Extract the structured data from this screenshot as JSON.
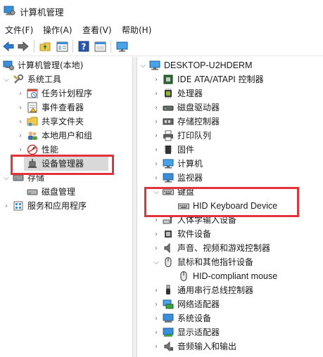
{
  "window": {
    "title": "计算机管理"
  },
  "menu": [
    {
      "label": "文件(F)"
    },
    {
      "label": "操作(A)"
    },
    {
      "label": "查看(V)"
    },
    {
      "label": "帮助(H)"
    }
  ],
  "toolbar": {
    "buttons": [
      "back-icon",
      "forward-icon",
      "up-folder-icon",
      "show-hide-console-tree-icon",
      "help-icon",
      "properties-icon",
      "monitor-icon"
    ]
  },
  "left_tree": {
    "root": "计算机管理(本地)",
    "system_tools": "系统工具",
    "task_scheduler": "任务计划程序",
    "event_viewer": "事件查看器",
    "shared_folders": "共享文件夹",
    "local_users": "本地用户和组",
    "performance": "性能",
    "device_manager": "设备管理器",
    "storage": "存储",
    "disk_management": "磁盘管理",
    "services_apps": "服务和应用程序"
  },
  "right_tree": {
    "computer_name": "DESKTOP-U2HDERM",
    "items": [
      {
        "label": "IDE ATA/ATAPI 控制器",
        "icon": "ide-controller-icon",
        "expanded": false
      },
      {
        "label": "处理器",
        "icon": "processor-icon",
        "expanded": false
      },
      {
        "label": "磁盘驱动器",
        "icon": "disk-drive-icon",
        "expanded": false
      },
      {
        "label": "存储控制器",
        "icon": "storage-controller-icon",
        "expanded": false
      },
      {
        "label": "打印队列",
        "icon": "printer-icon",
        "expanded": false
      },
      {
        "label": "固件",
        "icon": "firmware-icon",
        "expanded": false
      },
      {
        "label": "计算机",
        "icon": "computer-icon",
        "expanded": false
      },
      {
        "label": "监视器",
        "icon": "monitor-icon",
        "expanded": false
      },
      {
        "label": "键盘",
        "icon": "keyboard-icon",
        "expanded": true
      },
      {
        "label": "HID Keyboard Device",
        "icon": "keyboard-icon",
        "child": true
      },
      {
        "label": "人体学输入设备",
        "icon": "hid-icon",
        "expanded": false
      },
      {
        "label": "软件设备",
        "icon": "software-device-icon",
        "expanded": false
      },
      {
        "label": "声音、视频和游戏控制器",
        "icon": "speaker-icon",
        "expanded": false
      },
      {
        "label": "鼠标和其他指针设备",
        "icon": "mouse-icon",
        "expanded": true
      },
      {
        "label": "HID-compliant mouse",
        "icon": "mouse-icon",
        "child": true
      },
      {
        "label": "通用串行总线控制器",
        "icon": "usb-icon",
        "expanded": false
      },
      {
        "label": "网络适配器",
        "icon": "network-adapter-icon",
        "expanded": false
      },
      {
        "label": "系统设备",
        "icon": "system-device-icon",
        "expanded": false
      },
      {
        "label": "显示适配器",
        "icon": "display-adapter-icon",
        "expanded": false
      },
      {
        "label": "音频输入和输出",
        "icon": "audio-icon",
        "expanded": false
      }
    ]
  },
  "colors": {
    "highlight": "#e2323b",
    "selection": "#d9d9d9",
    "accent": "#1e73be"
  }
}
